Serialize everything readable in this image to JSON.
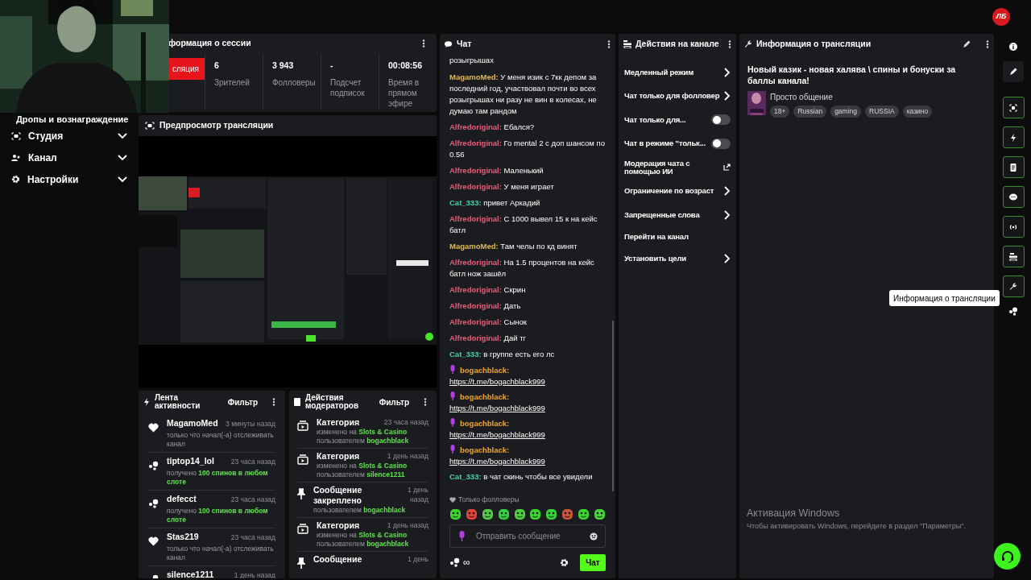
{
  "topbar": {
    "logo": "ЛБ"
  },
  "sidebar": {
    "items": [
      {
        "label": "Дропы и вознаграждение"
      },
      {
        "label": "Студия"
      },
      {
        "label": "Канал"
      },
      {
        "label": "Настройки"
      }
    ]
  },
  "session": {
    "title": "формация о сессии",
    "live_button": "сляция",
    "stats": [
      {
        "value": "6",
        "label": "Зрителей"
      },
      {
        "value": "3 943",
        "label": "Фолловеры"
      },
      {
        "value": "-",
        "label": "Подсчет подписок"
      },
      {
        "value": "00:08:56",
        "label": "Время в прямом эфире"
      }
    ]
  },
  "preview": {
    "title": "Предпросмотр трансляции"
  },
  "activity": {
    "title": "Лента активности",
    "filter": "Фильтр",
    "items": [
      {
        "kind": "follow",
        "user": "MagamoMed",
        "time": "3 минуты назад",
        "text": "только что начал(-а) отслеживать канал"
      },
      {
        "kind": "points",
        "user": "tiptop14_lol",
        "time": "23 часа назад",
        "text": "получено",
        "highlight": "100 спинов в любом слоте"
      },
      {
        "kind": "points",
        "user": "defecct",
        "time": "23 часа назад",
        "text": "получено",
        "highlight": "100 спинов в любом слоте"
      },
      {
        "kind": "follow",
        "user": "Stas219",
        "time": "23 часа назад",
        "text": "только что начал(-а) отслеживать канал"
      },
      {
        "kind": "points",
        "user": "silence1211",
        "time": "1 день назад"
      }
    ]
  },
  "mod_actions": {
    "title": "Действия модераторов",
    "filter": "Фильтр",
    "items": [
      {
        "kind": "category",
        "title": "Категория",
        "time": "23 часа назад",
        "lines": [
          {
            "text": "изменено на",
            "highlight": "Slots & Casino"
          },
          {
            "text": "пользователем",
            "highlight": "bogachblack"
          }
        ]
      },
      {
        "kind": "category",
        "title": "Категория",
        "time": "1 день назад",
        "lines": [
          {
            "text": "изменено на",
            "highlight": "Slots & Casino"
          },
          {
            "text": "пользователем",
            "highlight": "silence1211"
          }
        ]
      },
      {
        "kind": "pin",
        "title": "Сообщение закреплено",
        "time": "1 день назад",
        "lines": [
          {
            "text": "пользователем",
            "highlight": "bogachblack"
          }
        ]
      },
      {
        "kind": "category",
        "title": "Категория",
        "time": "1 день назад",
        "lines": [
          {
            "text": "изменено на",
            "highlight": "Slots & Casino"
          },
          {
            "text": "пользователем",
            "highlight": "bogachblack"
          }
        ]
      },
      {
        "kind": "pin",
        "title": "Сообщение",
        "time": "1 день"
      }
    ]
  },
  "chat": {
    "title": "Чат",
    "messages": [
      {
        "kind": "continuation",
        "text": "розыгрышах"
      },
      {
        "kind": "text",
        "user": "MagamoMed:",
        "color": "#e6b84a",
        "badge": false,
        "text": "У меня изик с 7кк депом за последний год, участвовал почти во всех розыгрышах ни разу не вин в колесах, не думаю там рандом"
      },
      {
        "kind": "text",
        "user": "Alfredoriginal:",
        "color": "#e0607e",
        "badge": false,
        "text": "Ебался?"
      },
      {
        "kind": "text",
        "user": "Alfredoriginal:",
        "color": "#e0607e",
        "badge": false,
        "text": "Го mental 2 с доп шансом по 0.56"
      },
      {
        "kind": "text",
        "user": "Alfredoriginal:",
        "color": "#e0607e",
        "badge": false,
        "text": "Маленький"
      },
      {
        "kind": "text",
        "user": "Alfredoriginal:",
        "color": "#e0607e",
        "badge": false,
        "text": "У меня играет"
      },
      {
        "kind": "text",
        "user": "Cat_333:",
        "color": "#3fd6a6",
        "badge": false,
        "text": "привет Аркадий"
      },
      {
        "kind": "text",
        "user": "Alfredoriginal:",
        "color": "#e0607e",
        "badge": false,
        "text": "С 1000 вывел 15 к на кейс батл"
      },
      {
        "kind": "text",
        "user": "MagamoMed:",
        "color": "#e6b84a",
        "badge": false,
        "text": "Там челы по кд винят"
      },
      {
        "kind": "text",
        "user": "Alfredoriginal:",
        "color": "#e0607e",
        "badge": false,
        "text": "На 1.5 процентов на кейс батл нож зашёл"
      },
      {
        "kind": "text",
        "user": "Alfredoriginal:",
        "color": "#e0607e",
        "badge": false,
        "text": "Скрин"
      },
      {
        "kind": "text",
        "user": "Alfredoriginal:",
        "color": "#e0607e",
        "badge": false,
        "text": "Дать"
      },
      {
        "kind": "text",
        "user": "Alfredoriginal:",
        "color": "#e0607e",
        "badge": false,
        "text": "Сынок"
      },
      {
        "kind": "text",
        "user": "Alfredoriginal:",
        "color": "#e0607e",
        "badge": false,
        "text": "Дай тг"
      },
      {
        "kind": "text",
        "user": "Cat_333:",
        "color": "#3fd6a6",
        "badge": false,
        "text": "в группе есть его лс"
      },
      {
        "kind": "link",
        "user": "bogachblack:",
        "color": "#f5a623",
        "badge": true,
        "text": "https://t.me/bogachblack999"
      },
      {
        "kind": "link",
        "user": "bogachblack:",
        "color": "#f5a623",
        "badge": true,
        "text": "https://t.me/bogachblack999"
      },
      {
        "kind": "link",
        "user": "bogachblack:",
        "color": "#f5a623",
        "badge": true,
        "text": "https://t.me/bogachblack999"
      },
      {
        "kind": "link",
        "user": "bogachblack:",
        "color": "#f5a623",
        "badge": true,
        "text": "https://t.me/bogachblack999"
      },
      {
        "kind": "text",
        "user": "Cat_333:",
        "color": "#3fd6a6",
        "badge": false,
        "text": "в чат скинь чтобы все увидели"
      }
    ],
    "followers_only": "Только фолловеры",
    "input": {
      "placeholder": "Отправить сообщение"
    },
    "points": "∞",
    "send": "Чат"
  },
  "channel_actions": {
    "title": "Действия на канале",
    "items": [
      {
        "label": "Медленный режим",
        "kind": "chevron"
      },
      {
        "label": "Чат только для фолловер",
        "kind": "chevron"
      },
      {
        "label": "Чат только для...",
        "kind": "toggle",
        "on": false
      },
      {
        "label": "Чат в режиме \"тольк...",
        "kind": "toggle",
        "on": false
      },
      {
        "label": "Модерация чата с помощью ИИ",
        "kind": "external"
      },
      {
        "label": "Ограничение по возраст",
        "kind": "chevron"
      },
      {
        "label": "Запрещенные слова",
        "kind": "chevron"
      },
      {
        "label": "Перейти на канал",
        "kind": "plain"
      },
      {
        "label": "Установить цели",
        "kind": "chevron"
      }
    ]
  },
  "stream_info": {
    "title": "Информация о трансляции",
    "stream_title": "Новый казик - новая халява \\ спины и бонуски за баллы канала!",
    "category": "Просто общение",
    "tags": [
      "18+",
      "Russian",
      "gaming",
      "RUSSIA",
      "казино"
    ]
  },
  "rail": {
    "tooltip": "Информация о трансляции"
  },
  "os_notice": {
    "title": "Активация Windows",
    "text": "Чтобы активировать Windows, перейдите в раздел \"Параметры\"."
  }
}
